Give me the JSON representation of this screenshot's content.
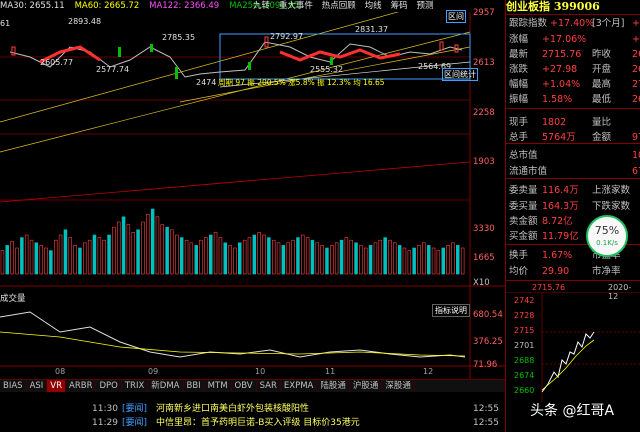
{
  "topbar": {
    "ma30": "MA30: 2655.11",
    "ma60": "MA60: 2665.72",
    "ma122": "MA122: 2366.49",
    "ma250": "MA250: 2091.95"
  },
  "toolbar": {
    "buttons": [
      "九转",
      "重大事件",
      "热点回顾",
      "均线",
      "筹码",
      "预测"
    ]
  },
  "price_axis": {
    "labels": [
      "2957",
      "2613",
      "2258",
      "1903"
    ],
    "lower_labels": [
      "3330",
      "1665",
      "X10"
    ],
    "sub_labels": [
      "680.54",
      "376.25",
      "71.96"
    ]
  },
  "chart": {
    "annotations": {
      "high1": "2893.48",
      "high2": "2785.35",
      "low1": "2605.77",
      "low2": "2577.74",
      "low3": "2474",
      "high3": "2792.97",
      "high4": "2831.37",
      "low4": "2555.32",
      "low5": "2564.69",
      "left": "61",
      "stat_line": "周期 97 振 200.5% 涨5.8% 振 12.3% 均 16.65",
      "range_btn": "区间统计",
      "top_btn": "区间"
    },
    "months": [
      "08",
      "09",
      "10",
      "11",
      "12"
    ],
    "volume_title": "成交量",
    "indicator_btn": "指标说明"
  },
  "sub_panel_title": "成交量",
  "tabs": {
    "items": [
      "BIAS",
      "ASI",
      "VR",
      "ARBR",
      "DPO",
      "TRIX",
      "新DMA",
      "BBI",
      "MTM",
      "OBV",
      "SAR",
      "EXPMA",
      "陆股通",
      "沪股通",
      "深股通"
    ],
    "active": "VR"
  },
  "news": [
    {
      "time": "11:30",
      "tag": "[要闻]",
      "text": "河南新乡进口南美白虾外包装核酸阳性",
      "time2": "12:55"
    },
    {
      "time": "11:29",
      "tag": "[要闻]",
      "text": "中信里昂：首予药明巨诺-B买入评级 目标价35港元",
      "time2": "12:55"
    }
  ],
  "panel": {
    "title": "创业板指 399006",
    "rows": [
      {
        "l": "跟踪指数",
        "v": "+17.40%",
        "l2": "[3个月]",
        "v2": "+"
      },
      {
        "l": "涨幅",
        "v": "+17.06%",
        "l2": "",
        "v2": "+"
      },
      {
        "l": "最新",
        "v": "2715.76",
        "l2": "昨收",
        "v2": "26"
      },
      {
        "l": "涨跌",
        "v": "+27.98",
        "l2": "开盘",
        "v2": "26"
      },
      {
        "l": "幅幅",
        "v": "+1.04%",
        "l2": "最高",
        "v2": "27"
      },
      {
        "l": "振幅",
        "v": "1.58%",
        "l2": "最低",
        "v2": "26"
      },
      {
        "l": "现手",
        "v": "1802",
        "l2": "量比",
        "v2": ""
      },
      {
        "l": "总手",
        "v": "5764万",
        "l2": "金额",
        "v2": "97"
      },
      {
        "l": "总市值",
        "v": "",
        "l2": "",
        "v2": "103"
      },
      {
        "l": "流通市值",
        "v": "",
        "l2": "",
        "v2": "67"
      },
      {
        "l": "委卖量",
        "v": "116.4万",
        "l2": "上涨家数",
        "v2": ""
      },
      {
        "l": "委买量",
        "v": "164.3万",
        "l2": "下跌家数",
        "v2": ""
      },
      {
        "l": "卖金额",
        "v": "8.72亿",
        "l2": "",
        "v2": ""
      },
      {
        "l": "买金额",
        "v": "11.79亿",
        "l2": "",
        "v2": ""
      },
      {
        "l": "换手",
        "v": "1.67%",
        "l2": "市盈率",
        "v2": ""
      },
      {
        "l": "均价",
        "v": "29.90",
        "l2": "市净率",
        "v2": ""
      }
    ],
    "mini_price": "2715.76",
    "mini_date": "2020-12",
    "mini_ticks": [
      "2742",
      "2728",
      "2715",
      "2701",
      "2688",
      "2674",
      "2660"
    ]
  },
  "gauge": {
    "percent": "75%",
    "speed": "0.1K/s"
  },
  "watermark": "头条 @红哥A",
  "colors": {
    "up": "#ff4040",
    "down": "#00c000",
    "accent": "#ffff00",
    "bg": "#000000"
  }
}
